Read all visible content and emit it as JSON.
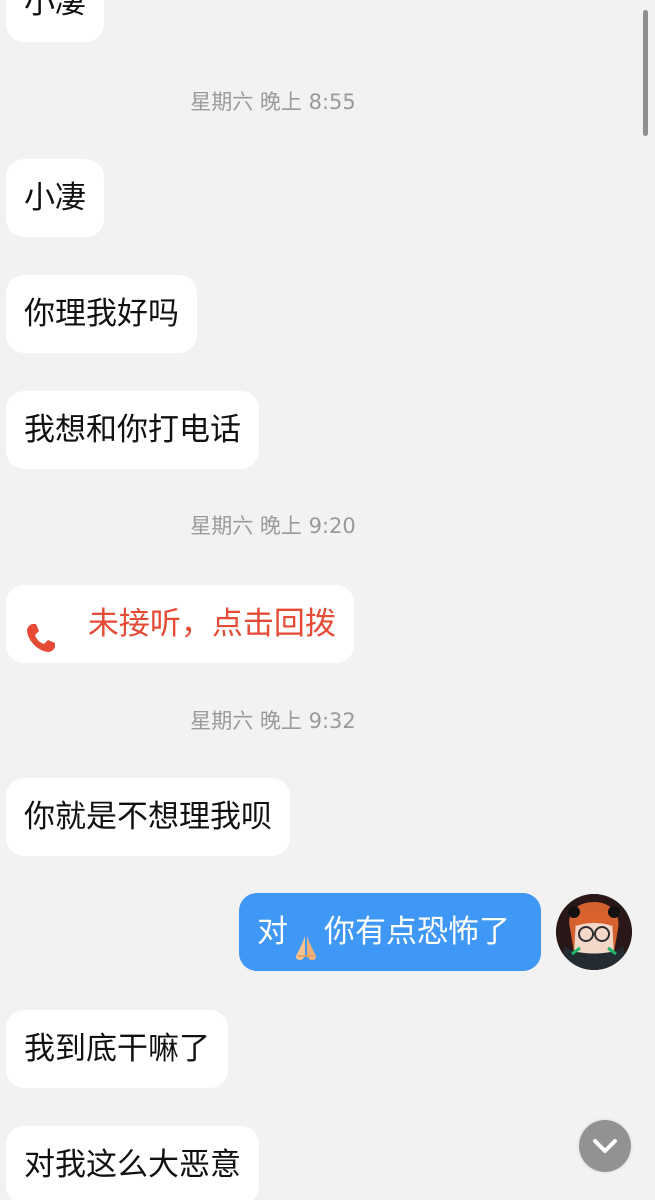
{
  "messages": [
    {
      "text": "小凄"
    },
    {
      "time": "星期六 晚上 8:55"
    },
    {
      "text": "小凄"
    },
    {
      "text": "你理我好吗"
    },
    {
      "text": "我想和你打电话"
    },
    {
      "time": "星期六 晚上 9:20"
    },
    {
      "call_text": "未接听，点击回拨"
    },
    {
      "time": "星期六 晚上 9:32"
    },
    {
      "text": "你就是不想理我呗"
    },
    {
      "outgoing_prefix": "对",
      "outgoing_suffix": "你有点恐怖了"
    },
    {
      "text": "我到底干嘛了"
    },
    {
      "text": "对我这么大恶意"
    }
  ],
  "icons": {
    "call": "phone-icon",
    "emoji": "hands-icon",
    "jump": "chevron-down-icon"
  },
  "colors": {
    "background": "#f2f2f2",
    "incoming_bubble": "#ffffff",
    "outgoing_bubble": "#3f97f6",
    "missed_call": "#e54b35",
    "timestamp": "#9a9a9a"
  }
}
